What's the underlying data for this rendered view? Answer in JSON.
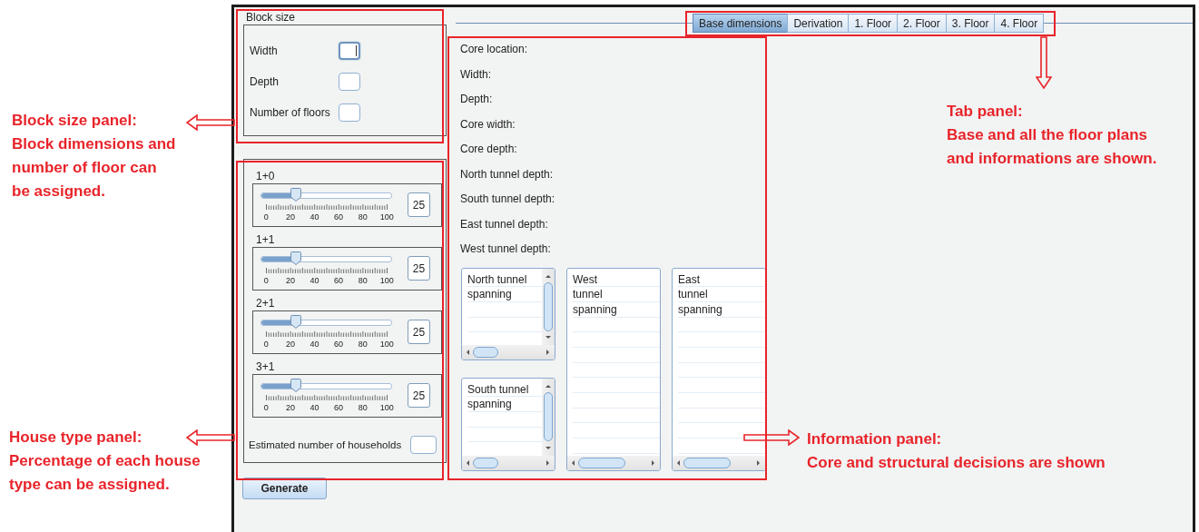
{
  "annotations": [
    {
      "kind": "left",
      "title": "Block size panel:",
      "lines": [
        "Block dimensions and",
        "number of floor can",
        "be assigned."
      ]
    },
    {
      "kind": "down",
      "title": "Tab panel:",
      "lines": [
        "Base and all the floor plans",
        "and informations are shown."
      ]
    },
    {
      "kind": "left",
      "title": "House type panel:",
      "lines": [
        "Percentage of each house",
        "type can be assigned."
      ]
    },
    {
      "kind": "right",
      "title": "Information panel:",
      "lines": [
        "Core and structural decisions are shown"
      ]
    }
  ],
  "block_size": {
    "title": "Block size",
    "fields": [
      {
        "label": "Width",
        "focused": true
      },
      {
        "label": "Depth",
        "focused": false
      },
      {
        "label": "Number of floors",
        "focused": false
      }
    ]
  },
  "house_types": [
    {
      "label": "1+0",
      "level": 0.25,
      "value": "25",
      "scale": [
        "0",
        "20",
        "40",
        "60",
        "80",
        "100"
      ]
    },
    {
      "label": "1+1",
      "level": 0.25,
      "value": "25",
      "scale": [
        "0",
        "20",
        "40",
        "60",
        "80",
        "100"
      ]
    },
    {
      "label": "2+1",
      "level": 0.25,
      "value": "25",
      "scale": [
        "0",
        "20",
        "40",
        "60",
        "80",
        "100"
      ]
    },
    {
      "label": "3+1",
      "level": 0.25,
      "value": "25",
      "scale": [
        "0",
        "20",
        "40",
        "60",
        "80",
        "100"
      ]
    }
  ],
  "households": {
    "label": "Estimated number of households"
  },
  "generate_button": "Generate",
  "tabs": [
    {
      "label": "Base dimensions",
      "selected": true
    },
    {
      "label": "Derivation",
      "selected": false
    },
    {
      "label": "1. Floor",
      "selected": false
    },
    {
      "label": "2. Floor",
      "selected": false
    },
    {
      "label": "3. Floor",
      "selected": false
    },
    {
      "label": "4. Floor",
      "selected": false
    }
  ],
  "info_labels": [
    "Core location:",
    "Width:",
    "Depth:",
    "Core width:",
    "Core depth:",
    "North tunnel depth:",
    "South tunnel depth:",
    "East tunnel depth:",
    "West tunnel depth:"
  ],
  "lists": [
    {
      "kind": "short",
      "lines": [
        "North tunnel",
        "spanning"
      ]
    },
    {
      "kind": "tall",
      "lines": [
        "West",
        "tunnel",
        "spanning"
      ]
    },
    {
      "kind": "tall",
      "lines": [
        "East",
        "tunnel",
        "spanning"
      ]
    },
    {
      "kind": "short",
      "lines": [
        "South tunnel",
        "spanning"
      ]
    }
  ]
}
